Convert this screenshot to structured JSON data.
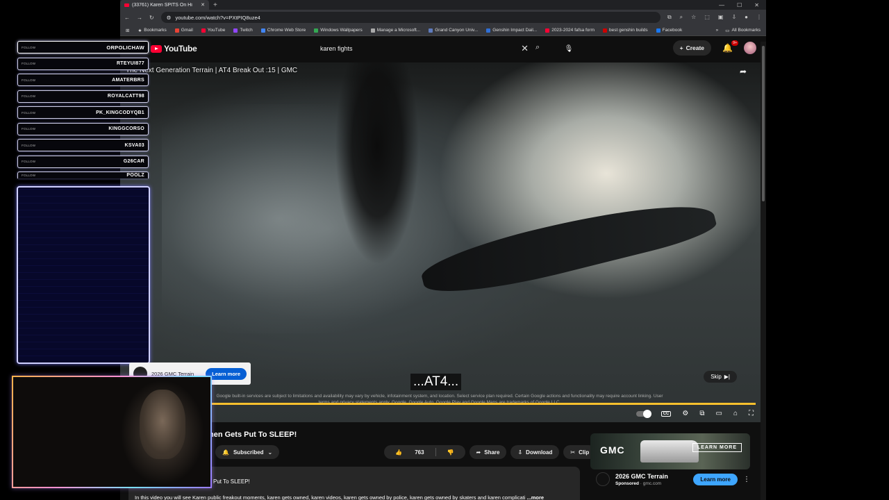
{
  "browser": {
    "tab_title": "(33761) Karen SPITS On Hi",
    "address": "youtube.com/watch?v=PXtPIQ8uze4",
    "bookmarks": [
      "Bookmarks",
      "Gmail",
      "YouTube",
      "Twitch",
      "Chrome Web Store",
      "Windows Wallpapers",
      "Manage a Microsoft...",
      "Grand Canyon Univ...",
      "Genshin Impact Dail...",
      "2023-2024 fafsa form",
      "best genshin builds",
      "Facebook"
    ],
    "all_bookmarks": "All Bookmarks",
    "bookmark_colors": [
      "#8ab4f8",
      "#ea4335",
      "#ff0033",
      "#9146ff",
      "#4285f4",
      "#34a853",
      "#aaaaaa",
      "#5e7bbd",
      "#2f6fd6",
      "#ff0033",
      "#cc0000",
      "#1877f2"
    ]
  },
  "youtube": {
    "logo_text": "YouTube",
    "search_query": "karen fights",
    "create_label": "Create",
    "notif_count": "9+"
  },
  "video": {
    "ad_title": "The Next Generation Terrain | AT4 Break Out :15 | GMC",
    "caption": "...AT4...",
    "disclaimer": "Google built-in services are subject to limitations and availability may vary by vehicle, infotainment system, and location. Select service plan required. Certain Google actions and functionality may require account linking. User terms and privacy statements apply. Google, Google Auto, Google Play and Google Maps are trademarks of Google LLC.",
    "skip_label": "Skip",
    "overlay_ad": {
      "title": "2026 GMC Terrain",
      "button": "Learn more"
    }
  },
  "below": {
    "title": "hen Gets Put To SLEEP!",
    "subscribed_label": "Subscribed",
    "like_count": "763",
    "share_label": "Share",
    "download_label": "Download",
    "clip_label": "Clip",
    "desc_title": "Put To SLEEP!",
    "desc_text": "In this video you will see Karen public freakout moments, karen gets owned, karen videos, karen gets owned by police, karen gets owned by skaters and karen complicati",
    "desc_more": "...more"
  },
  "sidebar_ad": {
    "brand": "GMC",
    "image_button": "LEARN MORE",
    "title": "2026 GMC Terrain",
    "sponsored": "Sponsored",
    "domain": "gmc.com",
    "button": "Learn more"
  },
  "overlay": {
    "follow_tag": "FOLLOW",
    "followers": [
      "ORPOLICHAW",
      "RTEYUI877",
      "AMATERBRS",
      "ROYALCATT98",
      "PK_KINGCODYQB1",
      "KINGGCORSO",
      "KSVA03",
      "G26CAR",
      "POOLZ"
    ]
  }
}
